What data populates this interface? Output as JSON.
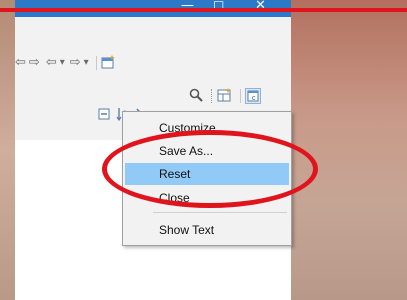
{
  "titlebar": {
    "minimize_icon": "minimize-icon",
    "maximize_icon": "maximize-icon",
    "close_icon": "close-icon",
    "minimize_glyph": "—",
    "maximize_glyph": "□",
    "close_glyph": "✕",
    "color": "#2b79c7"
  },
  "toolbar": {
    "nav_glyphs": {
      "back": "⇦",
      "forward": "⇨",
      "back_alt": "⇦",
      "dropdown": "▾",
      "forward_alt": "⇨",
      "dropdown2": "▾"
    },
    "search_glyph": "🔍",
    "az_glyph": "↓ᵃz"
  },
  "context_menu": {
    "items": [
      {
        "label": "Customize..."
      },
      {
        "label": "Save As..."
      },
      {
        "label": "Reset"
      },
      {
        "label": "Close"
      },
      {
        "label": "Show Text"
      }
    ],
    "selected_index": 2,
    "highlight_color": "#91c9f7"
  },
  "annotation": {
    "color": "#e0141d"
  }
}
